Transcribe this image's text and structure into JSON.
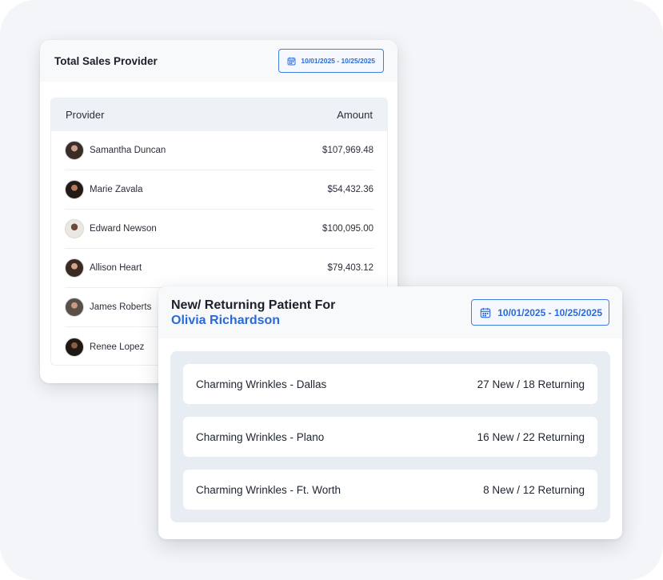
{
  "sales_card": {
    "title": "Total Sales Provider",
    "date_range": "10/01/2025 - 10/25/2025",
    "columns": {
      "provider": "Provider",
      "amount": "Amount"
    },
    "rows": [
      {
        "name": "Samantha Duncan",
        "amount": "$107,969.48"
      },
      {
        "name": "Marie Zavala",
        "amount": "$54,432.36"
      },
      {
        "name": "Edward Newson",
        "amount": "$100,095.00"
      },
      {
        "name": "Allison Heart",
        "amount": "$79,403.12"
      },
      {
        "name": "James Roberts",
        "amount": ""
      },
      {
        "name": "Renee Lopez",
        "amount": ""
      }
    ]
  },
  "patient_card": {
    "title_line1": "New/ Returning Patient For",
    "title_line2": "Olivia Richardson",
    "date_range": "10/01/2025 - 10/25/2025",
    "locations": [
      {
        "name": "Charming Wrinkles - Dallas",
        "stats": "27 New / 18 Returning"
      },
      {
        "name": "Charming Wrinkles - Plano",
        "stats": "16 New / 22 Returning"
      },
      {
        "name": "Charming Wrinkles - Ft. Worth",
        "stats": "8 New / 12 Returning"
      }
    ]
  },
  "colors": {
    "accent": "#2a6ad8",
    "background": "#f3f5f8",
    "table_header": "#eef1f5",
    "location_panel": "#e8edf4"
  },
  "icons": [
    "calendar-icon"
  ]
}
